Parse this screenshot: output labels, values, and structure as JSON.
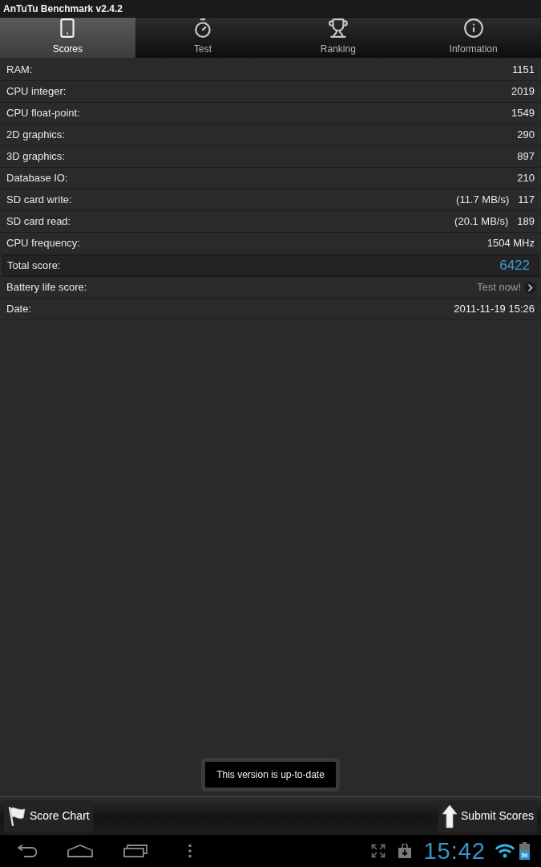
{
  "window": {
    "title": "AnTuTu Benchmark v2.4.2"
  },
  "tabs": [
    {
      "label": "Scores",
      "selected": true
    },
    {
      "label": "Test",
      "selected": false
    },
    {
      "label": "Ranking",
      "selected": false
    },
    {
      "label": "Information",
      "selected": false
    }
  ],
  "scores": [
    {
      "kind": "plain",
      "label": "RAM:",
      "value": "1151"
    },
    {
      "kind": "plain",
      "label": "CPU integer:",
      "value": "2019"
    },
    {
      "kind": "plain",
      "label": "CPU float-point:",
      "value": "1549"
    },
    {
      "kind": "plain",
      "label": "2D graphics:",
      "value": "290"
    },
    {
      "kind": "plain",
      "label": "3D graphics:",
      "value": "897"
    },
    {
      "kind": "plain",
      "label": "Database IO:",
      "value": "210"
    },
    {
      "kind": "plain",
      "label": "SD card write:",
      "detail": "(11.7 MB/s)",
      "value": "117"
    },
    {
      "kind": "plain",
      "label": "SD card read:",
      "detail": "(20.1 MB/s)",
      "value": "189"
    },
    {
      "kind": "plain",
      "label": "CPU frequency:",
      "value": "1504 MHz"
    },
    {
      "kind": "total",
      "label": "Total score:",
      "value": "6422"
    },
    {
      "kind": "link",
      "label": "Battery life score:",
      "value": "Test now!"
    },
    {
      "kind": "plain",
      "label": "Date:",
      "value": "2011-11-19 15:26"
    }
  ],
  "toast": {
    "text": "This version is up-to-date"
  },
  "bottom_bar": {
    "buttons": [
      {
        "label": "Score Chart"
      },
      {
        "label": "Submit Scores"
      }
    ]
  },
  "status_bar": {
    "time": "15:42",
    "battery": "50"
  }
}
